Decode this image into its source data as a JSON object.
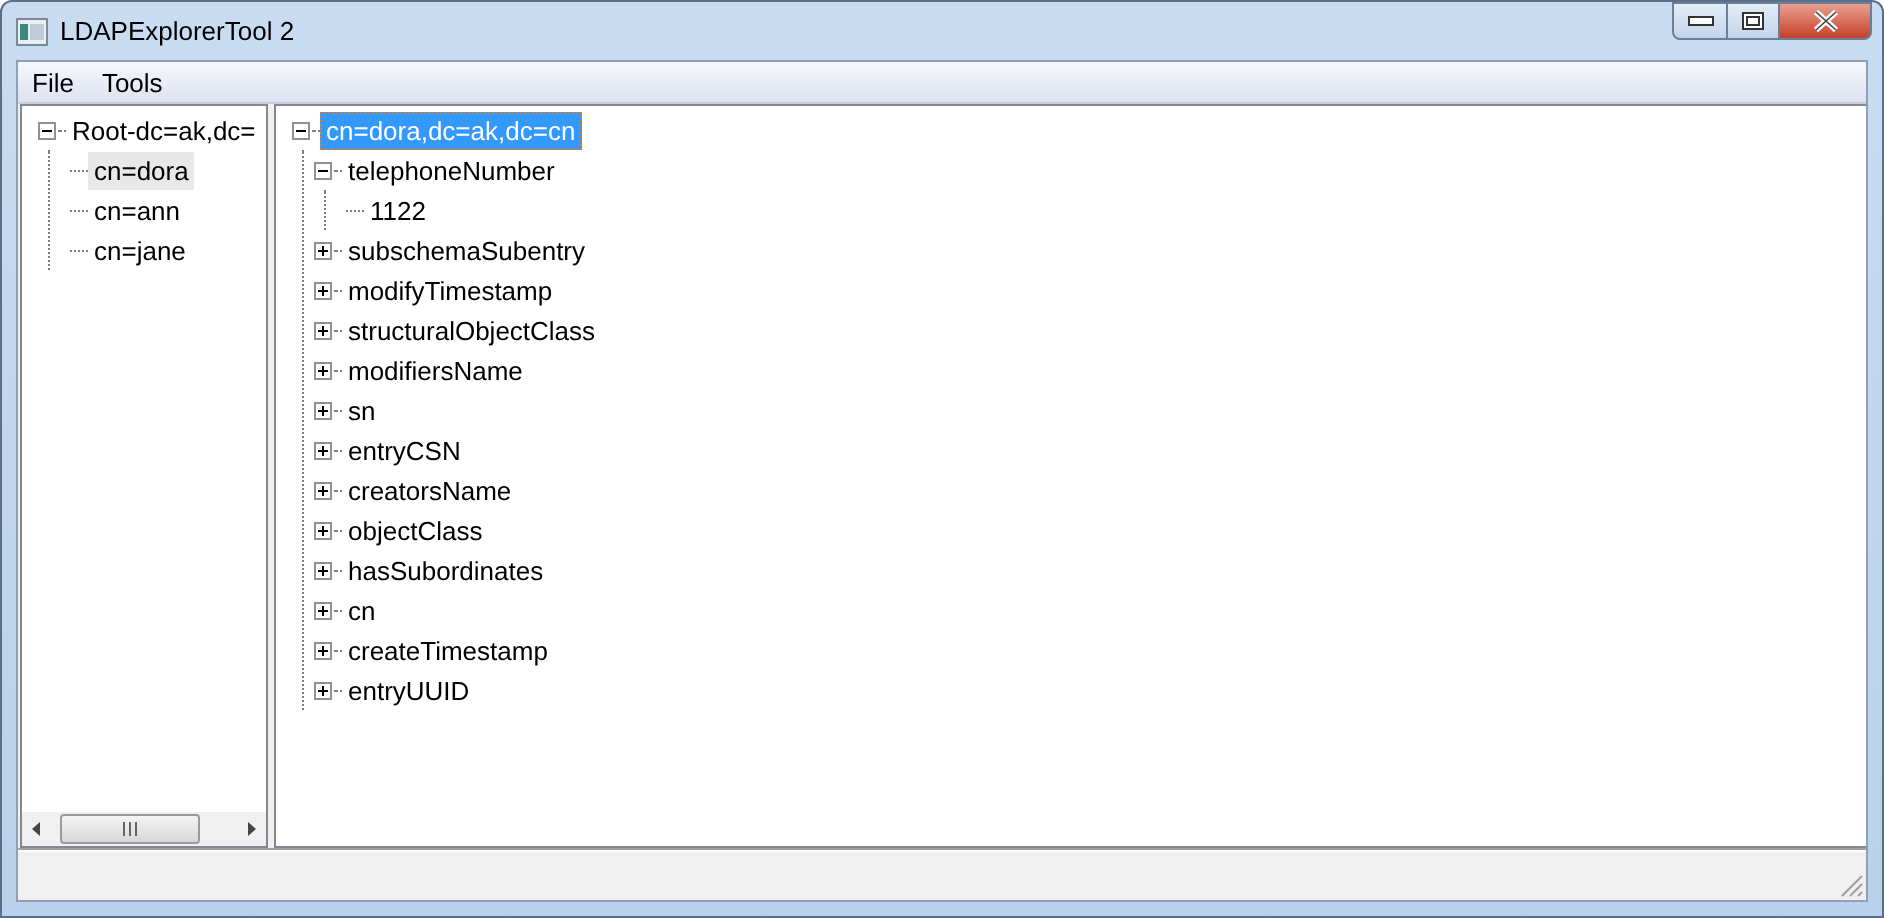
{
  "window": {
    "title": "LDAPExplorerTool 2"
  },
  "menu": [
    {
      "label": "File"
    },
    {
      "label": "Tools"
    }
  ],
  "left_tree": {
    "focused": false,
    "items": [
      {
        "label": "Root-dc=ak,dc=",
        "expanded": true,
        "selected": false,
        "children": [
          {
            "label": "cn=dora",
            "selected": true
          },
          {
            "label": "cn=ann",
            "selected": false
          },
          {
            "label": "cn=jane",
            "selected": false
          }
        ]
      }
    ]
  },
  "right_tree": {
    "focused": true,
    "items": [
      {
        "label": "cn=dora,dc=ak,dc=cn",
        "expanded": true,
        "selected": true,
        "children": [
          {
            "label": "telephoneNumber",
            "expanded": true,
            "selected": false,
            "children": [
              {
                "label": "1122",
                "selected": false
              }
            ]
          },
          {
            "label": "subschemaSubentry",
            "expanded": false,
            "selected": false
          },
          {
            "label": "modifyTimestamp",
            "expanded": false,
            "selected": false
          },
          {
            "label": "structuralObjectClass",
            "expanded": false,
            "selected": false
          },
          {
            "label": "modifiersName",
            "expanded": false,
            "selected": false
          },
          {
            "label": "sn",
            "expanded": false,
            "selected": false
          },
          {
            "label": "entryCSN",
            "expanded": false,
            "selected": false
          },
          {
            "label": "creatorsName",
            "expanded": false,
            "selected": false
          },
          {
            "label": "objectClass",
            "expanded": false,
            "selected": false
          },
          {
            "label": "hasSubordinates",
            "expanded": false,
            "selected": false
          },
          {
            "label": "cn",
            "expanded": false,
            "selected": false
          },
          {
            "label": "createTimestamp",
            "expanded": false,
            "selected": false
          },
          {
            "label": "entryUUID",
            "expanded": false,
            "selected": false
          }
        ]
      }
    ]
  }
}
